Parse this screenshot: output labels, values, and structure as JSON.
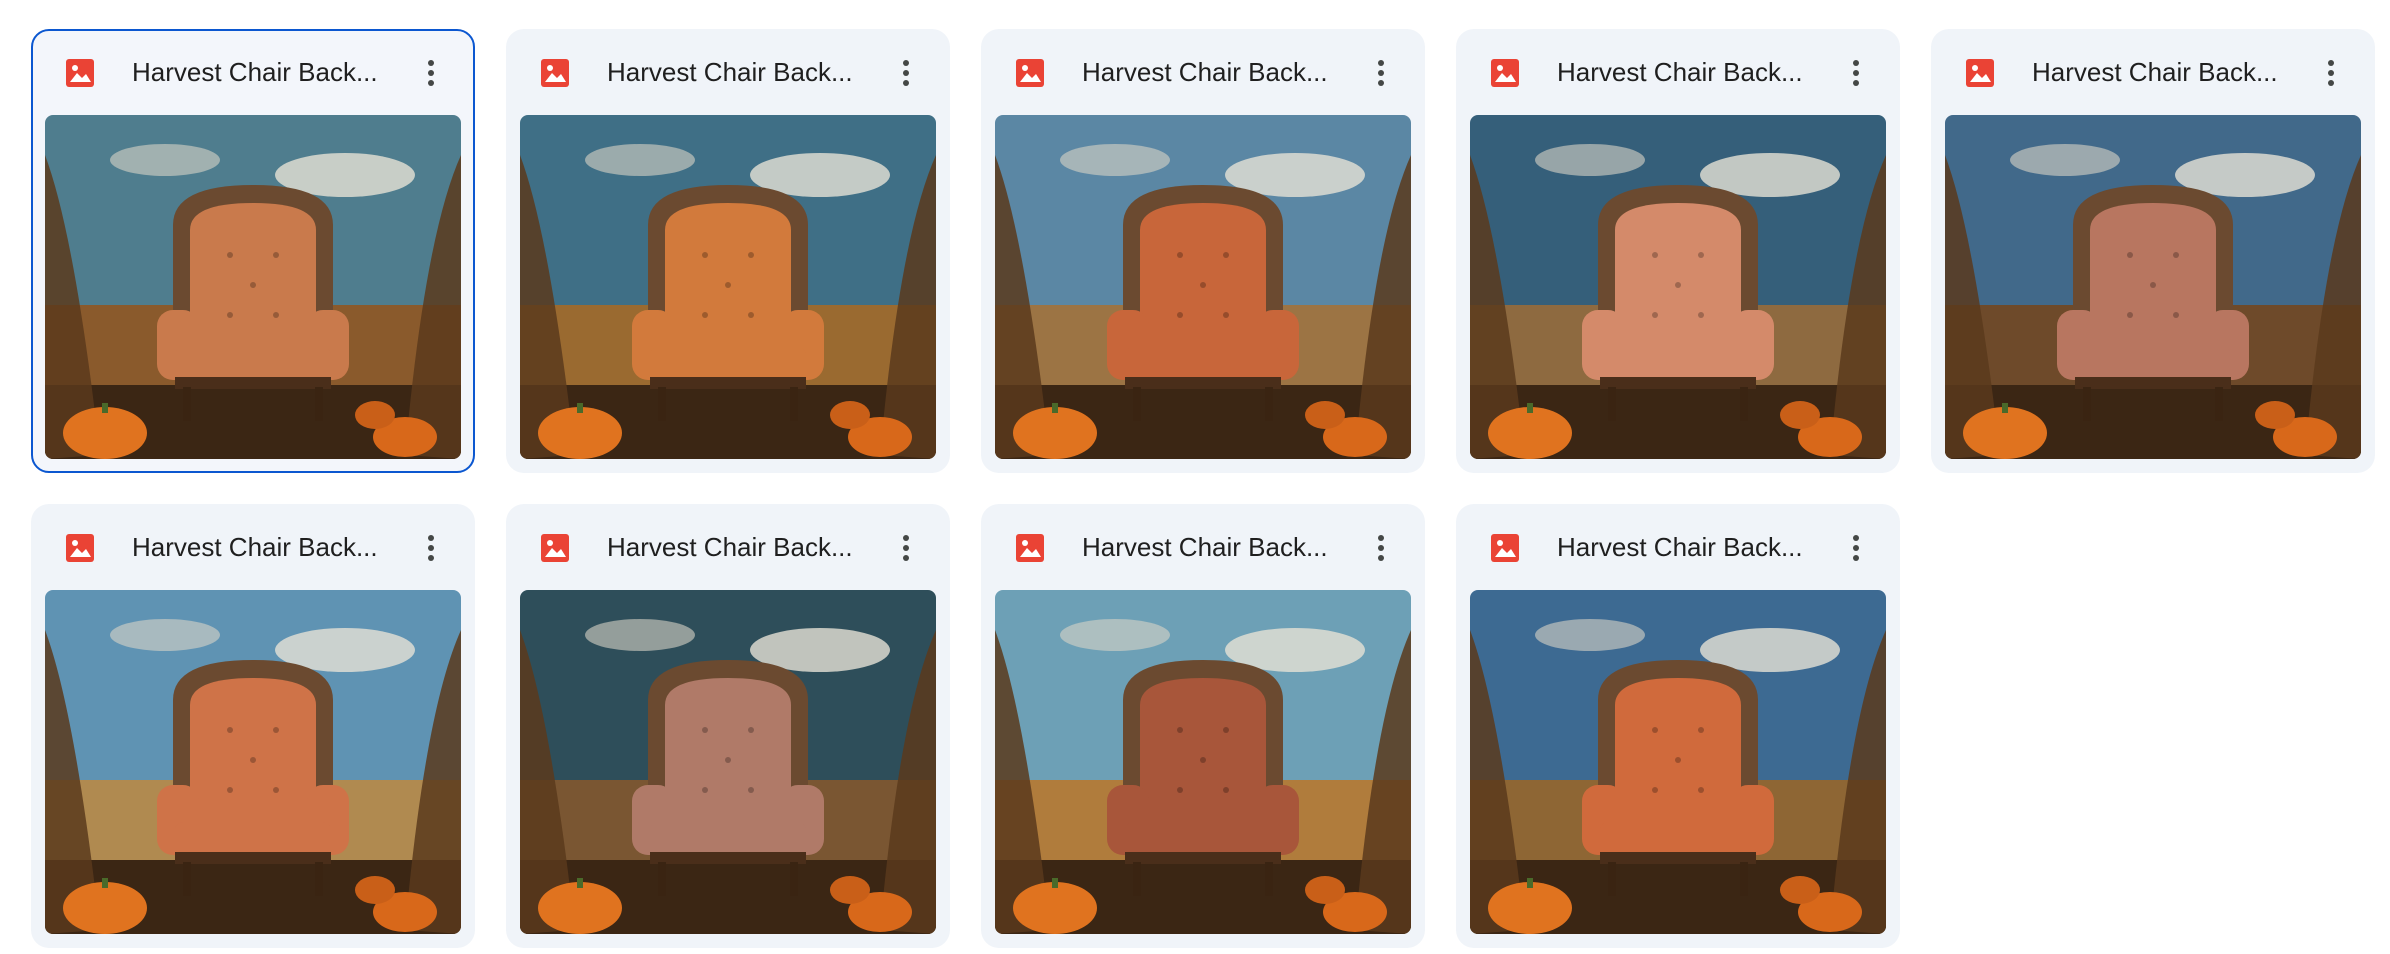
{
  "colors": {
    "accent": "#0b57d0",
    "card_bg": "#f0f4f9",
    "image_icon": "#ea4335"
  },
  "files": [
    {
      "title": "Harvest Chair Back...",
      "icon": "image-icon",
      "selected": true,
      "sky": "#4f7d8e",
      "chair": "#c97a4c",
      "field": "#8a5a2c"
    },
    {
      "title": "Harvest Chair Back...",
      "icon": "image-icon",
      "selected": false,
      "sky": "#3f6f86",
      "chair": "#d27a3c",
      "field": "#9a6a30"
    },
    {
      "title": "Harvest Chair Back...",
      "icon": "image-icon",
      "selected": false,
      "sky": "#5b87a4",
      "chair": "#c8663a",
      "field": "#9c7444"
    },
    {
      "title": "Harvest Chair Back...",
      "icon": "image-icon",
      "selected": false,
      "sky": "#355f7a",
      "chair": "#d48a6a",
      "field": "#8e6a40"
    },
    {
      "title": "Harvest Chair Back...",
      "icon": "image-icon",
      "selected": false,
      "sky": "#41698a",
      "chair": "#b87660",
      "field": "#6e4a2a"
    },
    {
      "title": "Harvest Chair Back...",
      "icon": "image-icon",
      "selected": false,
      "sky": "#5f93b3",
      "chair": "#cf7348",
      "field": "#b08a50"
    },
    {
      "title": "Harvest Chair Back...",
      "icon": "image-icon",
      "selected": false,
      "sky": "#2e4e5a",
      "chair": "#b07a68",
      "field": "#7a5632"
    },
    {
      "title": "Harvest Chair Back...",
      "icon": "image-icon",
      "selected": false,
      "sky": "#6da0b6",
      "chair": "#a8563a",
      "field": "#b07c3c"
    },
    {
      "title": "Harvest Chair Back...",
      "icon": "image-icon",
      "selected": false,
      "sky": "#3d6a92",
      "chair": "#d06a3c",
      "field": "#8e6634"
    }
  ]
}
